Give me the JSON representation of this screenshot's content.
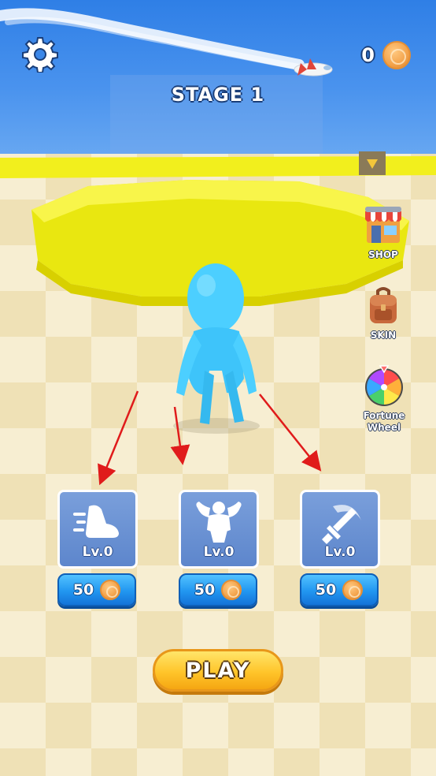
{
  "hud": {
    "stage_label": "STAGE 1",
    "coins": "0",
    "settings_icon": "gear-icon",
    "coin_icon": "coin-icon"
  },
  "side_menu": [
    {
      "label": "SHOP",
      "icon": "shop-icon"
    },
    {
      "label": "SKIN",
      "icon": "backpack-icon"
    },
    {
      "label": "Fortune Wheel",
      "icon": "fortune-wheel-icon"
    }
  ],
  "upgrades": [
    {
      "icon": "speed-foot-icon",
      "level": "Lv.0",
      "price": "50"
    },
    {
      "icon": "strength-muscle-icon",
      "level": "Lv.0",
      "price": "50"
    },
    {
      "icon": "sword-attack-icon",
      "level": "Lv.0",
      "price": "50"
    }
  ],
  "play_button": {
    "label": "PLAY"
  },
  "colors": {
    "sky": "#3b87e8",
    "arena_wall": "#f4f00e",
    "character": "#4ccfff",
    "upgrade_card": "#6b92d4",
    "buy_button": "#2196f0",
    "play_button": "#ffc52a",
    "arrow": "#e01b1b"
  }
}
